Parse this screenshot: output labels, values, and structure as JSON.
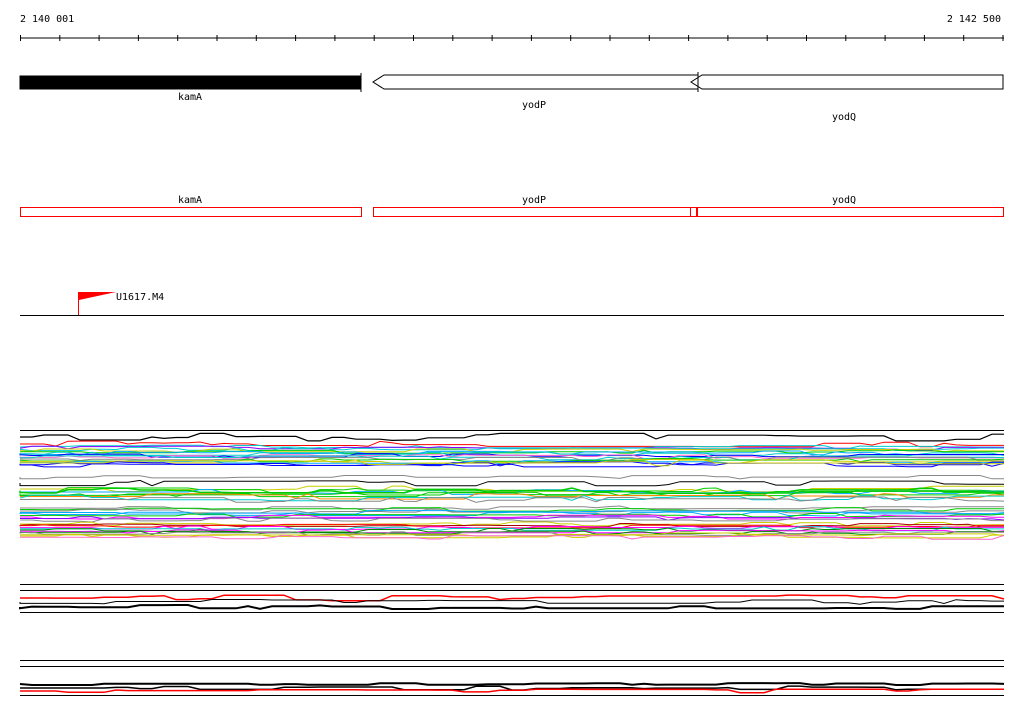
{
  "coordinates": {
    "start_label": "2 140 001",
    "end_label": "2 142 500"
  },
  "genes": {
    "kamA": "kamA",
    "yodP": "yodP",
    "yodQ": "yodQ"
  },
  "transcripts": {
    "kamA": "kamA",
    "yodP": "yodP",
    "yodQ": "yodQ"
  },
  "marker": {
    "label": "U1617.M4",
    "color": "#ff0000"
  },
  "colors": {
    "gene_fill": "#000000",
    "transcript": "#ff0000",
    "axis": "#000000"
  }
}
